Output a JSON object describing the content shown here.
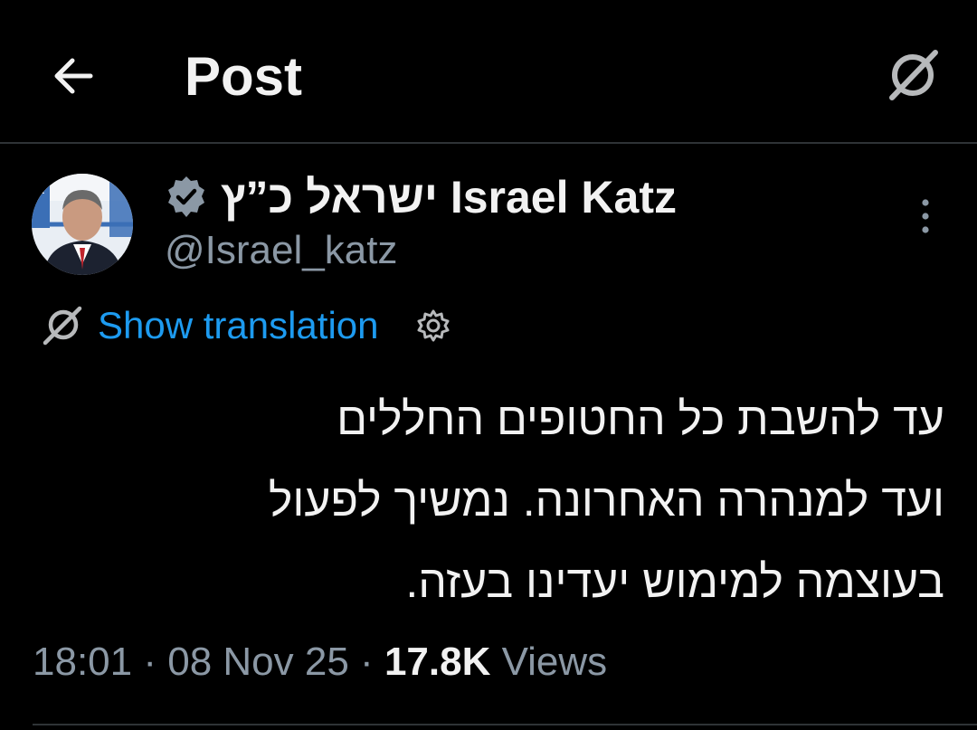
{
  "header": {
    "title": "Post"
  },
  "author": {
    "display_name": "ישראל כ”ץ Israel Katz",
    "handle": "@Israel_katz"
  },
  "translation": {
    "label": "Show translation"
  },
  "tweet": {
    "lines": [
      "עד להשבת כל החטופים החללים",
      "ועד למנהרה האחרונה. נמשיך לפעול",
      "בעוצמה למימוש יעדינו בעזה."
    ]
  },
  "meta": {
    "time": "18:01",
    "date": "08 Nov 25",
    "views_count": "17.8K",
    "views_label": "Views"
  },
  "icons": {
    "back": "arrow-left-icon",
    "grok": "grok-icon",
    "verified": "verified-badge-icon",
    "more": "more-vertical-icon",
    "translate": "grok-icon",
    "settings": "gear-icon"
  },
  "colors": {
    "background": "#000000",
    "text": "#f2f2f2",
    "muted": "#8b98a5",
    "link": "#1d9bf0"
  }
}
